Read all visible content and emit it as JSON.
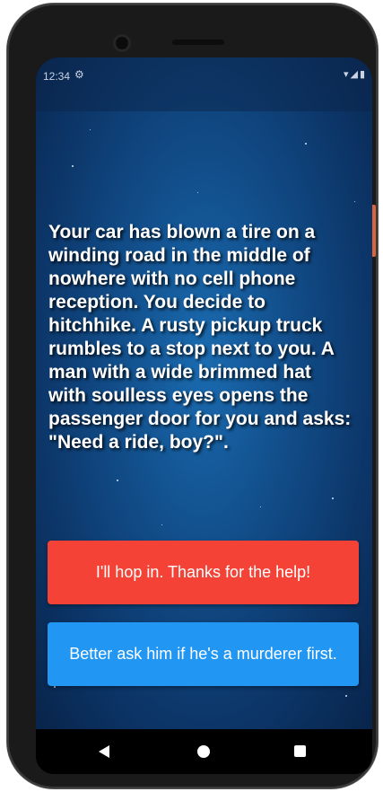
{
  "status_bar": {
    "time": "12:34",
    "settings_icon": "gear-icon",
    "wifi_icon": "wifi-icon",
    "signal_icon": "signal-icon",
    "battery_icon": "battery-icon"
  },
  "story": {
    "text": "Your car has blown a tire on a winding road in the middle of nowhere with no cell phone reception. You decide to hitchhike. A rusty pickup truck rumbles to a stop next to you. A man with a wide brimmed hat with soulless eyes opens the passenger door for you and asks: \"Need a ride, boy?\"."
  },
  "choices": [
    {
      "label": "I'll hop in. Thanks for the help!",
      "color": "#f44336"
    },
    {
      "label": "Better ask him if he's a murderer first.",
      "color": "#2196f3"
    }
  ],
  "nav_bar": {
    "back_icon": "back-triangle-icon",
    "home_icon": "home-circle-icon",
    "recents_icon": "recents-square-icon"
  },
  "colors": {
    "background": "#124f8c",
    "text": "#ffffff"
  }
}
